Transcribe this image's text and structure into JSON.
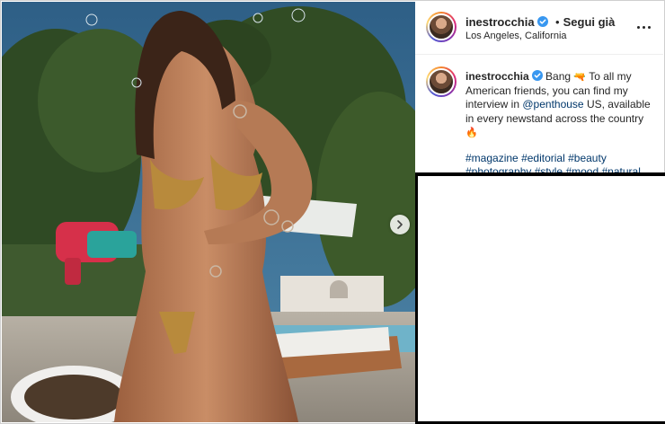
{
  "post": {
    "username": "inestrocchia",
    "follow_label": "Segui già",
    "separator": "•",
    "location": "Los Angeles, California",
    "caption_segments": {
      "start": "Bang",
      "emoji_gun": "🔫",
      "mid": "To all my American friends, you can find my interview in",
      "mention": "@penthouse",
      "end": "US, available in every newstand across the country",
      "emoji_fire": "🔥"
    },
    "hashtags": [
      "#magazine",
      "#editorial",
      "#beauty",
      "#photography",
      "#style",
      "#mood",
      "#natural"
    ]
  },
  "icons": {
    "verified": "verified-badge-icon",
    "more": "more-options-icon",
    "next": "chevron-right-icon"
  },
  "colors": {
    "verified_blue": "#3897f0",
    "link_blue": "#00376b",
    "text": "#262626"
  }
}
